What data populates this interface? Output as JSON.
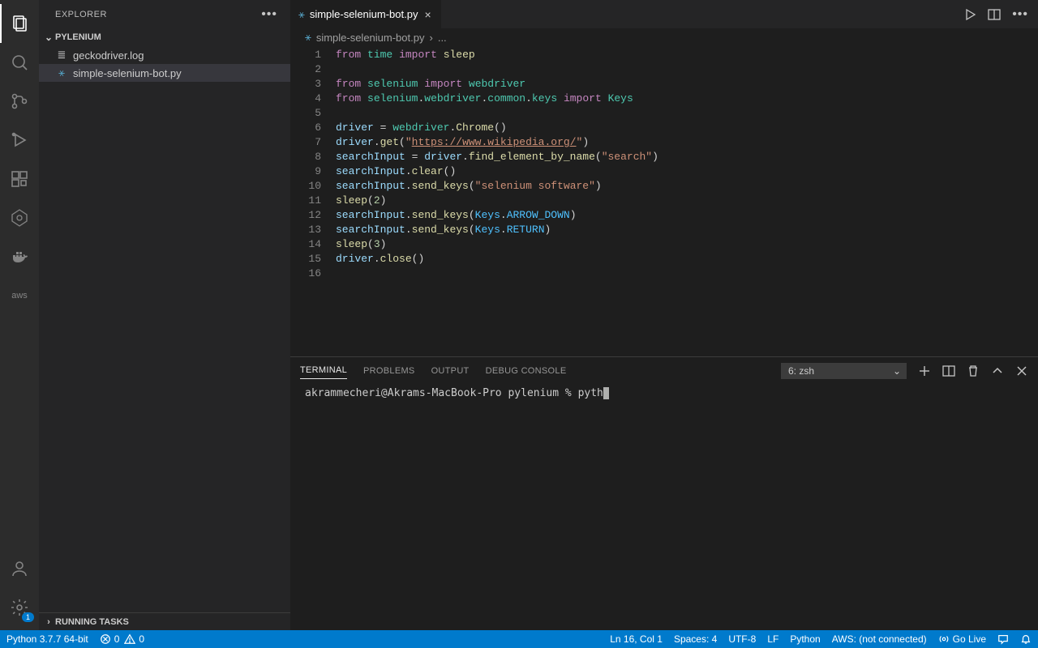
{
  "sidebar": {
    "title": "EXPLORER",
    "project": "PYLENIUM",
    "files": [
      {
        "name": "geckodriver.log",
        "icon": "≣"
      },
      {
        "name": "simple-selenium-bot.py",
        "icon": "⚹",
        "active": true
      }
    ],
    "running_tasks": "RUNNING TASKS"
  },
  "tab": {
    "filename": "simple-selenium-bot.py"
  },
  "breadcrumb": {
    "file": "simple-selenium-bot.py",
    "rest": "..."
  },
  "code": {
    "lines": 16
  },
  "panel": {
    "tabs": [
      "TERMINAL",
      "PROBLEMS",
      "OUTPUT",
      "DEBUG CONSOLE"
    ],
    "active_tab": "TERMINAL",
    "terminal_selector": "6: zsh",
    "prompt_user": "akrammecheri@Akrams-MacBook-Pro",
    "prompt_dir": "pylenium",
    "prompt_symbol": "%",
    "typed": "pyth"
  },
  "statusbar": {
    "python": "Python 3.7.7 64-bit",
    "errors": "0",
    "warnings": "0",
    "ln_col": "Ln 16, Col 1",
    "spaces": "Spaces: 4",
    "encoding": "UTF-8",
    "eol": "LF",
    "lang": "Python",
    "aws": "AWS: (not connected)",
    "golive": "Go Live"
  },
  "activity": {
    "settings_badge": "1"
  }
}
